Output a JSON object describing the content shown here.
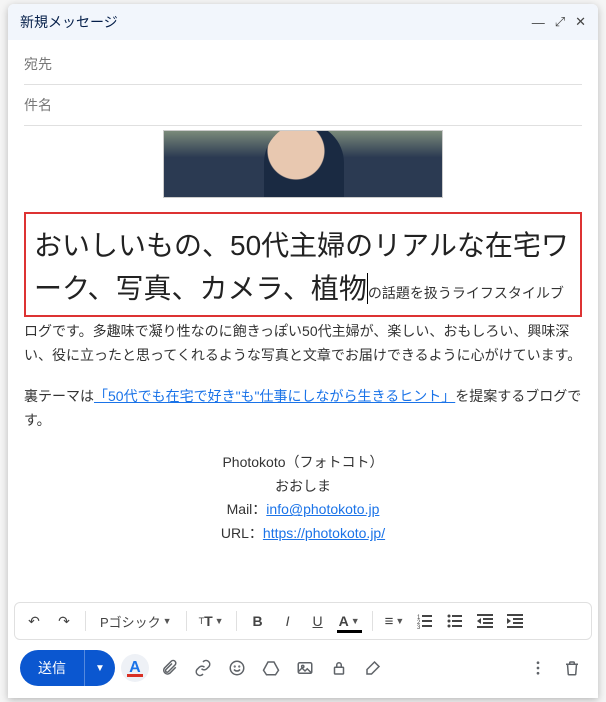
{
  "header": {
    "title": "新規メッセージ"
  },
  "fields": {
    "to_placeholder": "宛先",
    "subject_placeholder": "件名"
  },
  "body": {
    "big_text": "おいしいもの、50代主婦のリアルな在宅ワーク、写真、カメラ、植物",
    "after_big_line": "の話題を扱うライフスタイルブ",
    "para1": "ログです。多趣味で凝り性なのに飽きっぽい50代主婦が、楽しい、おもしろい、興味深い、役に立ったと思ってくれるような写真と文章でお届けできるように心がけています。",
    "para2_pre": "裏テーマは",
    "para2_link": "「50代でも在宅で好き\"も\"仕事にしながら生きるヒント」",
    "para2_post": "を提案するブログです。",
    "sig_name": "Photokoto（フォトコト）",
    "sig_person": "おおしま",
    "sig_mail_label": "Mail：",
    "sig_mail": "info@photokoto.jp",
    "sig_url_label": "URL：",
    "sig_url": "https://photokoto.jp/"
  },
  "toolbar": {
    "font_name": "Pゴシック",
    "size_label": "⁠T⁠T"
  },
  "actions": {
    "send_label": "送信"
  }
}
